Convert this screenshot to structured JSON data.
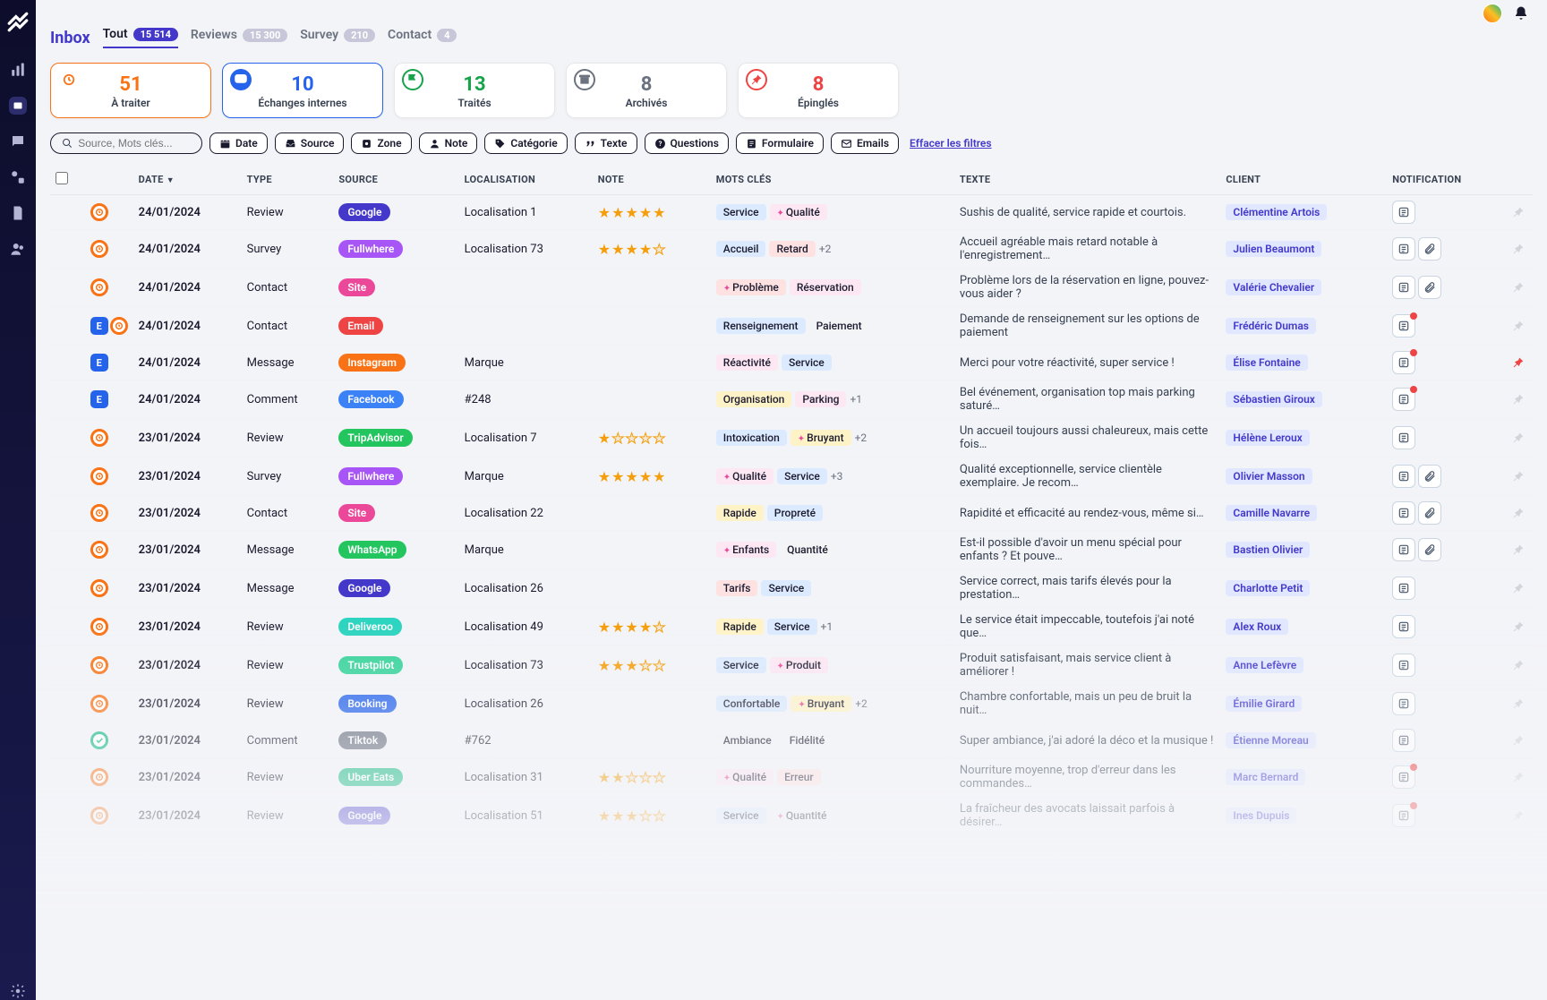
{
  "app": {
    "title": "Inbox"
  },
  "tabs": [
    {
      "label": "Tout",
      "count": "15 514",
      "active": true
    },
    {
      "label": "Reviews",
      "count": "15 300",
      "active": false
    },
    {
      "label": "Survey",
      "count": "210",
      "active": false
    },
    {
      "label": "Contact",
      "count": "4",
      "active": false
    }
  ],
  "stats": [
    {
      "num": "51",
      "label": "À traiter",
      "color": "#f97316",
      "iconColor": "#f97316",
      "active": "orange",
      "icon": "clock"
    },
    {
      "num": "10",
      "label": "Échanges internes",
      "color": "#2563eb",
      "iconColor": "#2563eb",
      "active": "blue",
      "icon": "chat"
    },
    {
      "num": "13",
      "label": "Traités",
      "color": "#16a34a",
      "iconColor": "#16a34a",
      "active": "",
      "icon": "flag"
    },
    {
      "num": "8",
      "label": "Archivés",
      "color": "#6b7280",
      "iconColor": "#6b7280",
      "active": "",
      "icon": "archive"
    },
    {
      "num": "8",
      "label": "Épinglés",
      "color": "#ef4444",
      "iconColor": "#ef4444",
      "active": "",
      "icon": "pin"
    }
  ],
  "search": {
    "placeholder": "Source, Mots clés..."
  },
  "filters": [
    {
      "icon": "calendar",
      "label": "Date"
    },
    {
      "icon": "inbox",
      "label": "Source"
    },
    {
      "icon": "target",
      "label": "Zone"
    },
    {
      "icon": "user",
      "label": "Note"
    },
    {
      "icon": "tag",
      "label": "Catégorie"
    },
    {
      "icon": "quote",
      "label": "Texte"
    },
    {
      "icon": "help",
      "label": "Questions"
    },
    {
      "icon": "form",
      "label": "Formulaire"
    },
    {
      "icon": "mail",
      "label": "Emails"
    }
  ],
  "clear_filters": "Effacer les filtres",
  "columns": {
    "date": "DATE",
    "type": "TYPE",
    "source": "SOURCE",
    "localisation": "LOCALISATION",
    "note": "NOTE",
    "mots": "MOTS CLÉS",
    "texte": "TEXTE",
    "client": "CLIENT",
    "notification": "NOTIFICATION"
  },
  "source_colors": {
    "Google": "#4338ca",
    "Fullwhere": "#a855f7",
    "Site": "#ec4899",
    "Email": "#ef4444",
    "Instagram": "#f97316",
    "Facebook": "#3b82f6",
    "TripAdvisor": "#22c55e",
    "WhatsApp": "#22c55e",
    "Deliveroo": "#2dd4bf",
    "Trustpilot": "#34d399",
    "Booking": "#2563eb",
    "Tiktok": "#6b7280",
    "Uber Eats": "#10b981"
  },
  "keyword_colors": {
    "Service": "#dbeafe",
    "Qualité": "#fce7f3",
    "Accueil": "#dbeafe",
    "Retard": "#fee2e2",
    "Problème": "#fee2e2",
    "Réservation": "#fce7f3",
    "Renseignement": "#dbeafe",
    "Paiement": "#f3f4f6",
    "Réactivité": "#fce7f3",
    "Organisation": "#fef3c7",
    "Parking": "#fce7f3",
    "Intoxication": "#dbeafe",
    "Bruyant": "#fef3c7",
    "Rapide": "#fef3c7",
    "Propreté": "#dbeafe",
    "Enfants": "#fce7f3",
    "Quantité": "#f3f4f6",
    "Tarifs": "#fee2e2",
    "Produit": "#fce7f3",
    "Confortable": "#dbeafe",
    "Ambiance": "#f3f4f6",
    "Fidélité": "#f3f4f6",
    "Erreur": "#fee2e2"
  },
  "rows": [
    {
      "status": [
        "orange-ring"
      ],
      "date": "24/01/2024",
      "type": "Review",
      "source": "Google",
      "loc": "Localisation 1",
      "stars": 5,
      "kw": [
        "Service",
        "✨Qualité"
      ],
      "texte": "Sushis de qualité, service rapide et courtois.",
      "client": "Clémentine Artois",
      "notif": [
        "note"
      ],
      "pinned": false
    },
    {
      "status": [
        "orange-ring"
      ],
      "date": "24/01/2024",
      "type": "Survey",
      "source": "Fullwhere",
      "loc": "Localisation 73",
      "stars": 4,
      "kw": [
        "Accueil",
        "Retard",
        "+2"
      ],
      "texte": "Accueil agréable mais retard notable à l'enregistrement…",
      "client": "Julien Beaumont",
      "notif": [
        "note",
        "attach"
      ],
      "pinned": false
    },
    {
      "status": [
        "orange-ring"
      ],
      "date": "24/01/2024",
      "type": "Contact",
      "source": "Site",
      "loc": "",
      "stars": 0,
      "kw": [
        "✨Problème",
        "Réservation"
      ],
      "texte": "Problème lors de la réservation en ligne, pouvez-vous aider ?",
      "client": "Valérie Chevalier",
      "notif": [
        "note",
        "attach"
      ],
      "pinned": false
    },
    {
      "status": [
        "blue-square",
        "orange-ring"
      ],
      "date": "24/01/2024",
      "type": "Contact",
      "source": "Email",
      "loc": "",
      "stars": 0,
      "kw": [
        "Renseignement",
        "Paiement"
      ],
      "texte": "Demande de renseignement sur les options de paiement",
      "client": "Frédéric Dumas",
      "notif": [
        "note-dot"
      ],
      "pinned": false
    },
    {
      "status": [
        "blue-square"
      ],
      "date": "24/01/2024",
      "type": "Message",
      "source": "Instagram",
      "loc": "Marque",
      "stars": 0,
      "kw": [
        "Réactivité",
        "Service"
      ],
      "texte": "Merci pour votre réactivité, super service !",
      "client": "Élise Fontaine",
      "notif": [
        "note-dot"
      ],
      "pinned": true
    },
    {
      "status": [
        "blue-square"
      ],
      "date": "24/01/2024",
      "type": "Comment",
      "source": "Facebook",
      "loc": "#248",
      "stars": 0,
      "kw": [
        "Organisation",
        "Parking",
        "+1"
      ],
      "texte": "Bel événement, organisation top mais parking saturé…",
      "client": "Sébastien Giroux",
      "notif": [
        "note-dot"
      ],
      "pinned": false
    },
    {
      "status": [
        "orange-ring"
      ],
      "date": "23/01/2024",
      "type": "Review",
      "source": "TripAdvisor",
      "loc": "Localisation 7",
      "stars": 1,
      "kw": [
        "Intoxication",
        "✨Bruyant",
        "+2"
      ],
      "texte": "Un accueil toujours aussi chaleureux, mais cette fois…",
      "client": "Hélène Leroux",
      "notif": [
        "note"
      ],
      "pinned": false
    },
    {
      "status": [
        "orange-ring"
      ],
      "date": "23/01/2024",
      "type": "Survey",
      "source": "Fullwhere",
      "loc": "Marque",
      "stars": 5,
      "kw": [
        "✨Qualité",
        "Service",
        "+3"
      ],
      "texte": "Qualité exceptionnelle, service clientèle exemplaire. Je recom…",
      "client": "Olivier Masson",
      "notif": [
        "note",
        "attach"
      ],
      "pinned": false
    },
    {
      "status": [
        "orange-ring"
      ],
      "date": "23/01/2024",
      "type": "Contact",
      "source": "Site",
      "loc": "Localisation 22",
      "stars": 0,
      "kw": [
        "Rapide",
        "Propreté"
      ],
      "texte": "Rapidité et efficacité au rendez-vous, même si…",
      "client": "Camille Navarre",
      "notif": [
        "note",
        "attach"
      ],
      "pinned": false
    },
    {
      "status": [
        "orange-ring"
      ],
      "date": "23/01/2024",
      "type": "Message",
      "source": "WhatsApp",
      "loc": "Marque",
      "stars": 0,
      "kw": [
        "✨Enfants",
        "Quantité"
      ],
      "texte": "Est-il possible d'avoir un menu spécial pour enfants ? Et pouve…",
      "client": "Bastien Olivier",
      "notif": [
        "note",
        "attach"
      ],
      "pinned": false
    },
    {
      "status": [
        "orange-ring"
      ],
      "date": "23/01/2024",
      "type": "Message",
      "source": "Google",
      "loc": "Localisation 26",
      "stars": 0,
      "kw": [
        "Tarifs",
        "Service"
      ],
      "texte": "Service correct, mais tarifs élevés pour la prestation…",
      "client": "Charlotte Petit",
      "notif": [
        "note"
      ],
      "pinned": false
    },
    {
      "status": [
        "orange-ring"
      ],
      "date": "23/01/2024",
      "type": "Review",
      "source": "Deliveroo",
      "loc": "Localisation 49",
      "stars": 4,
      "kw": [
        "Rapide",
        "Service",
        "+1"
      ],
      "texte": "Le service était impeccable, toutefois j'ai noté que…",
      "client": "Alex Roux",
      "notif": [
        "note"
      ],
      "pinned": false
    },
    {
      "status": [
        "orange-ring"
      ],
      "date": "23/01/2024",
      "type": "Review",
      "source": "Trustpilot",
      "loc": "Localisation 73",
      "stars": 3,
      "kw": [
        "Service",
        "✨Produit"
      ],
      "texte": "Produit satisfaisant, mais service client à améliorer !",
      "client": "Anne Lefèvre",
      "notif": [
        "note"
      ],
      "pinned": false
    },
    {
      "status": [
        "orange-ring"
      ],
      "date": "23/01/2024",
      "type": "Review",
      "source": "Booking",
      "loc": "Localisation 26",
      "stars": 0,
      "kw": [
        "Confortable",
        "✨Bruyant",
        "+2"
      ],
      "texte": "Chambre confortable, mais un peu de bruit la nuit…",
      "client": "Émilie Girard",
      "notif": [
        "note"
      ],
      "pinned": false
    },
    {
      "status": [
        "green-ring"
      ],
      "date": "23/01/2024",
      "type": "Comment",
      "source": "Tiktok",
      "loc": "#762",
      "stars": 0,
      "kw": [
        "Ambiance",
        "Fidélité"
      ],
      "texte": "Super ambiance, j'ai adoré la déco et la musique !",
      "client": "Étienne Moreau",
      "notif": [
        "note"
      ],
      "pinned": false
    },
    {
      "status": [
        "orange-ring"
      ],
      "date": "23/01/2024",
      "type": "Review",
      "source": "Uber Eats",
      "loc": "Localisation 31",
      "stars": 2,
      "kw": [
        "✨Qualité",
        "Erreur"
      ],
      "texte": "Nourriture moyenne, trop d'erreur dans les commandes…",
      "client": "Marc Bernard",
      "notif": [
        "note-dot"
      ],
      "pinned": false
    },
    {
      "status": [
        "orange-ring"
      ],
      "date": "23/01/2024",
      "type": "Review",
      "source": "Google",
      "loc": "Localisation 51",
      "stars": 3,
      "kw": [
        "Service",
        "✨Quantité"
      ],
      "texte": "La fraîcheur des avocats laissait parfois à désirer…",
      "client": "Ines Dupuis",
      "notif": [
        "note-dot"
      ],
      "pinned": false
    }
  ]
}
